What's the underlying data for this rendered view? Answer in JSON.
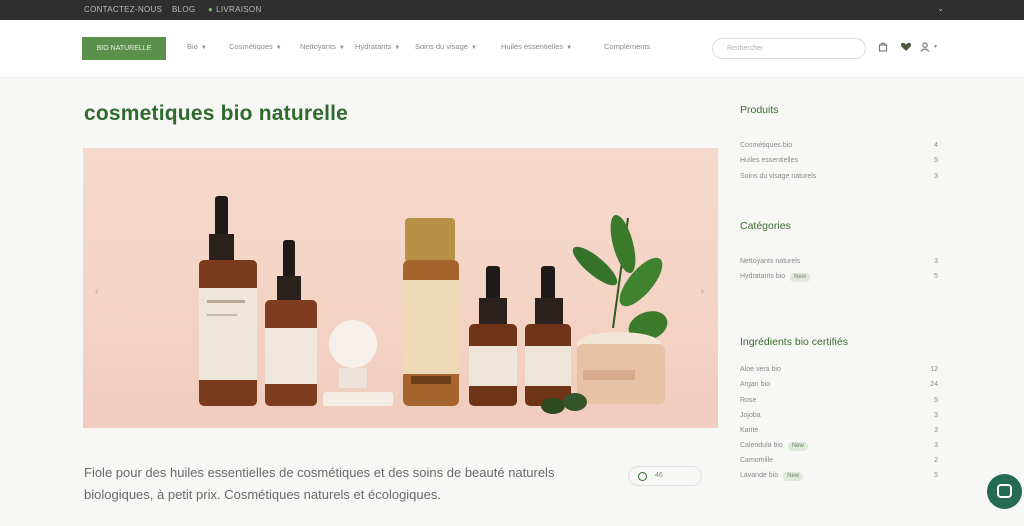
{
  "topbar": {
    "item_1": "CONTACTEZ-NOUS",
    "item_2": "BLOG",
    "item_3": "LIVRAISON"
  },
  "header": {
    "logo_label": "BIO NATURELLE",
    "menu": [
      {
        "label": "Bio"
      },
      {
        "label": "Cosmétiques"
      },
      {
        "label": "Nettoyants"
      },
      {
        "label": "Hydratants"
      },
      {
        "label": "Soins du visage"
      },
      {
        "label": "Huiles essentielles"
      },
      {
        "label": "Compléments"
      }
    ],
    "search_placeholder": "Rechercher"
  },
  "main": {
    "title": "cosmetiques bio naturelle",
    "description": "Fiole pour des huiles essentielles de cosmétiques et des soins de beauté naturels biologiques, à petit prix. Cosmétiques naturels et écologiques.",
    "share_label": "46"
  },
  "sidebar": {
    "sections": [
      {
        "heading": "Produits",
        "items": [
          {
            "label": "Cosmétiques bio",
            "count": "4"
          },
          {
            "label": "Huiles essentielles",
            "count": "5"
          },
          {
            "label": "Soins du visage naturels",
            "count": "3"
          }
        ]
      },
      {
        "heading": "Catégories",
        "items": [
          {
            "label": "Nettoyants naturels",
            "count": "3"
          },
          {
            "label": "Hydratants bio",
            "badge": "New",
            "count": "5"
          }
        ]
      },
      {
        "heading": "Ingrédients bio certifiés",
        "items": [
          {
            "label": "Aloe vera bio",
            "count": "12"
          },
          {
            "label": "Argan bio",
            "count": "24"
          },
          {
            "label": "Rose",
            "count": "5"
          },
          {
            "label": "Jojoba",
            "count": "3"
          },
          {
            "label": "Karité",
            "count": "3"
          },
          {
            "label": "Calendula bio",
            "badge": "New",
            "count": "3"
          },
          {
            "label": "Camomille",
            "count": "2"
          },
          {
            "label": "Lavande bio",
            "badge": "New",
            "count": "5"
          }
        ]
      }
    ]
  },
  "colors": {
    "brand_green": "#5a8f4c",
    "title_green": "#2f6b2d",
    "chat_green": "#256b53",
    "hero_bg": "#f3d2c3"
  },
  "icons": {
    "search": "search-icon",
    "cart": "cart-icon",
    "heart": "heart-icon",
    "user": "user-icon",
    "chat": "chat-icon"
  }
}
